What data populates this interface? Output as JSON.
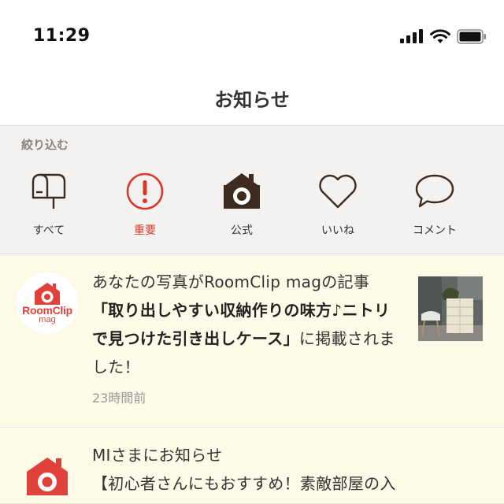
{
  "status_bar": {
    "time": "11:29",
    "icons": [
      "cellular-signal-icon",
      "wifi-icon",
      "battery-icon"
    ]
  },
  "nav": {
    "title": "お知らせ"
  },
  "filter": {
    "label": "絞り込む",
    "tabs": [
      {
        "label": "すべて",
        "icon": "mailbox-icon"
      },
      {
        "label": "重要",
        "icon": "exclamation-icon",
        "color": "#d8392c"
      },
      {
        "label": "公式",
        "icon": "roomclip-house-icon"
      },
      {
        "label": "いいね",
        "icon": "heart-icon"
      },
      {
        "label": "コメント",
        "icon": "speech-bubble-icon"
      }
    ]
  },
  "notifications": [
    {
      "avatar_brand": "RoomClip",
      "avatar_sub": "mag",
      "text_before": "あなたの写真がRoomClip magの記事",
      "text_bold": "「取り出しやすい収納作りの味方♪ニトリで見つけた引き出しケース」",
      "text_after": "に掲載されました！",
      "time": "23時間前",
      "has_thumbnail": true
    },
    {
      "avatar_brand": "",
      "text_line1": "MIさまにお知らせ",
      "text_line2": "【初心者さんにもおすすめ！素敵部屋の入門"
    }
  ],
  "colors": {
    "accent_red": "#e0413a",
    "important_red": "#d8392c",
    "notification_bg": "#fdfbe8",
    "filter_bg": "#f3f2f1",
    "icon_dark": "#3d2b1f"
  }
}
